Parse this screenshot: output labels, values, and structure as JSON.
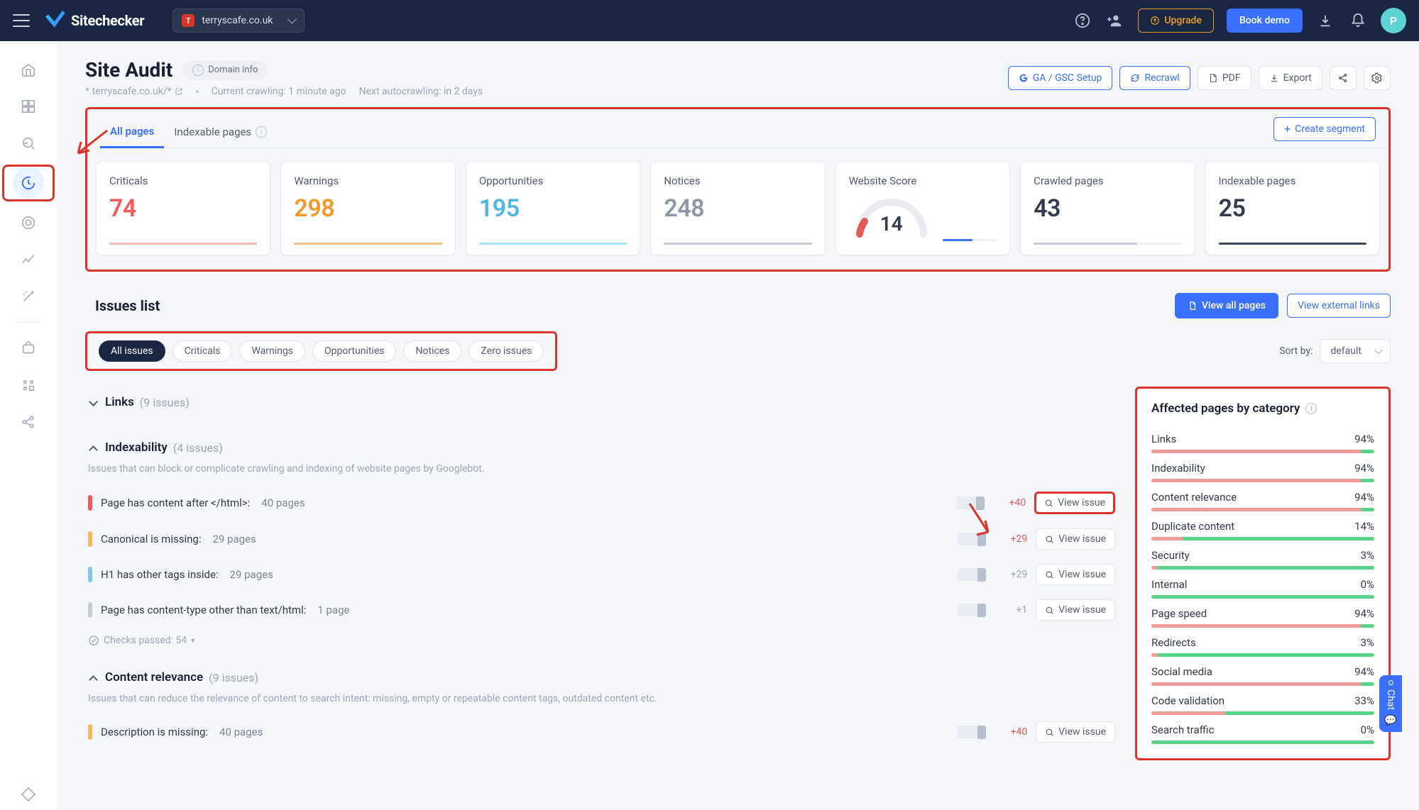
{
  "brand": "Sitechecker",
  "domain_selector": {
    "badge": "T",
    "domain": "terryscafe.co.uk"
  },
  "topbar": {
    "upgrade": "Upgrade",
    "book_demo": "Book demo",
    "avatar_initial": "P"
  },
  "page": {
    "title": "Site Audit",
    "domain_info": "Domain info",
    "scope": "*.terryscafe.co.uk/*",
    "crawl_status": "Current crawling: 1 minute ago",
    "next_crawl": "Next autocrawling: in 2 days"
  },
  "header_actions": {
    "ga_setup": "GA / GSC Setup",
    "recrawl": "Recrawl",
    "pdf": "PDF",
    "export": "Export"
  },
  "tabs": {
    "all_pages": "All pages",
    "indexable_pages": "Indexable pages",
    "create_segment": "Create segment"
  },
  "stats": {
    "criticals": {
      "label": "Criticals",
      "value": "74"
    },
    "warnings": {
      "label": "Warnings",
      "value": "298"
    },
    "opportunities": {
      "label": "Opportunities",
      "value": "195"
    },
    "notices": {
      "label": "Notices",
      "value": "248"
    },
    "score": {
      "label": "Website Score",
      "value": "14"
    },
    "crawled": {
      "label": "Crawled pages",
      "value": "43"
    },
    "indexable": {
      "label": "Indexable pages",
      "value": "25"
    }
  },
  "issues_list": {
    "title": "Issues list",
    "view_all_pages": "View all pages",
    "view_external": "View external links",
    "sort_label": "Sort by:",
    "sort_value": "default"
  },
  "filters": {
    "all": "All issues",
    "criticals": "Criticals",
    "warnings": "Warnings",
    "opportunities": "Opportunities",
    "notices": "Notices",
    "zero": "Zero issues"
  },
  "groups": {
    "links": {
      "title": "Links",
      "count": "(9 issues)"
    },
    "indexability": {
      "title": "Indexability",
      "count": "(4 issues)",
      "desc": "Issues that can block or complicate crawling and indexing of website pages by Googlebot."
    },
    "content_relevance": {
      "title": "Content relevance",
      "count": "(9 issues)",
      "desc": "Issues that can reduce the relevance of content to search intent: missing, empty or repeatable content tags, outdated content etc."
    }
  },
  "issue_rows": {
    "html_after": {
      "name": "Page has content after </html>:",
      "pages": "40 pages",
      "delta": "+40"
    },
    "canonical_missing": {
      "name": "Canonical is missing:",
      "pages": "29 pages",
      "delta": "+29"
    },
    "h1_tags": {
      "name": "H1 has other tags inside:",
      "pages": "29 pages",
      "delta": "+29"
    },
    "content_type": {
      "name": "Page has content-type other than text/html:",
      "pages": "1 page",
      "delta": "+1"
    },
    "desc_missing": {
      "name": "Description is missing:",
      "pages": "40 pages",
      "delta": "+40"
    }
  },
  "checks_passed": "Checks passed: 54",
  "view_issue": "View issue",
  "categories": {
    "title": "Affected pages by category",
    "items": [
      {
        "name": "Links",
        "pct": "94%",
        "bad": 94
      },
      {
        "name": "Indexability",
        "pct": "94%",
        "bad": 94
      },
      {
        "name": "Content relevance",
        "pct": "94%",
        "bad": 94
      },
      {
        "name": "Duplicate content",
        "pct": "14%",
        "bad": 14
      },
      {
        "name": "Security",
        "pct": "3%",
        "bad": 3
      },
      {
        "name": "Internal",
        "pct": "0%",
        "bad": 0
      },
      {
        "name": "Page speed",
        "pct": "94%",
        "bad": 94
      },
      {
        "name": "Redirects",
        "pct": "3%",
        "bad": 3
      },
      {
        "name": "Social media",
        "pct": "94%",
        "bad": 94
      },
      {
        "name": "Code validation",
        "pct": "33%",
        "bad": 33
      },
      {
        "name": "Search traffic",
        "pct": "0%",
        "bad": 0
      }
    ]
  },
  "chat_label": "Chat"
}
